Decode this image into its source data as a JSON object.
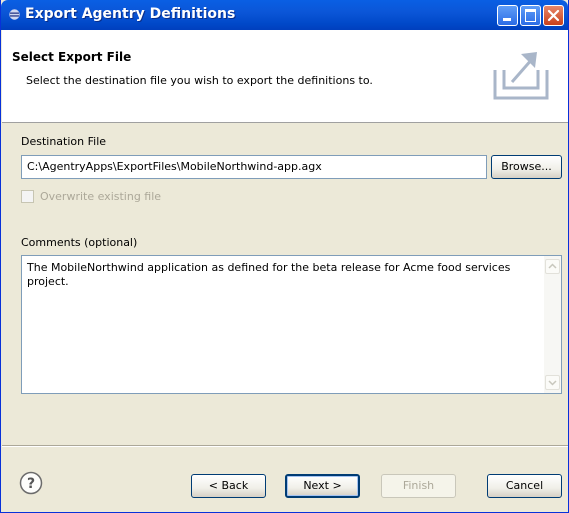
{
  "window": {
    "title": "Export Agentry Definitions",
    "title_icon": "eclipse-icon",
    "controls": [
      "minimize",
      "maximize",
      "close"
    ]
  },
  "banner": {
    "title": "Select Export File",
    "description": "Select the destination file you wish to export the definitions to.",
    "icon": "export-wizard-icon"
  },
  "destination": {
    "label": "Destination File",
    "value": "C:\\AgentryApps\\ExportFiles\\MobileNorthwind-app.agx",
    "browse_label": "Browse..."
  },
  "overwrite": {
    "label": "Overwrite existing file",
    "checked": false,
    "enabled": false
  },
  "comments": {
    "label": "Comments (optional)",
    "value": "The MobileNorthwind application as defined for the beta release for Acme food services project."
  },
  "buttons": {
    "back": "< Back",
    "next": "Next >",
    "finish": "Finish",
    "cancel": "Cancel"
  },
  "colors": {
    "titlebar": "#0a5fe4",
    "dialog_bg": "#ece9d8",
    "disabled_text": "#aca899",
    "field_border": "#7f9db9"
  }
}
